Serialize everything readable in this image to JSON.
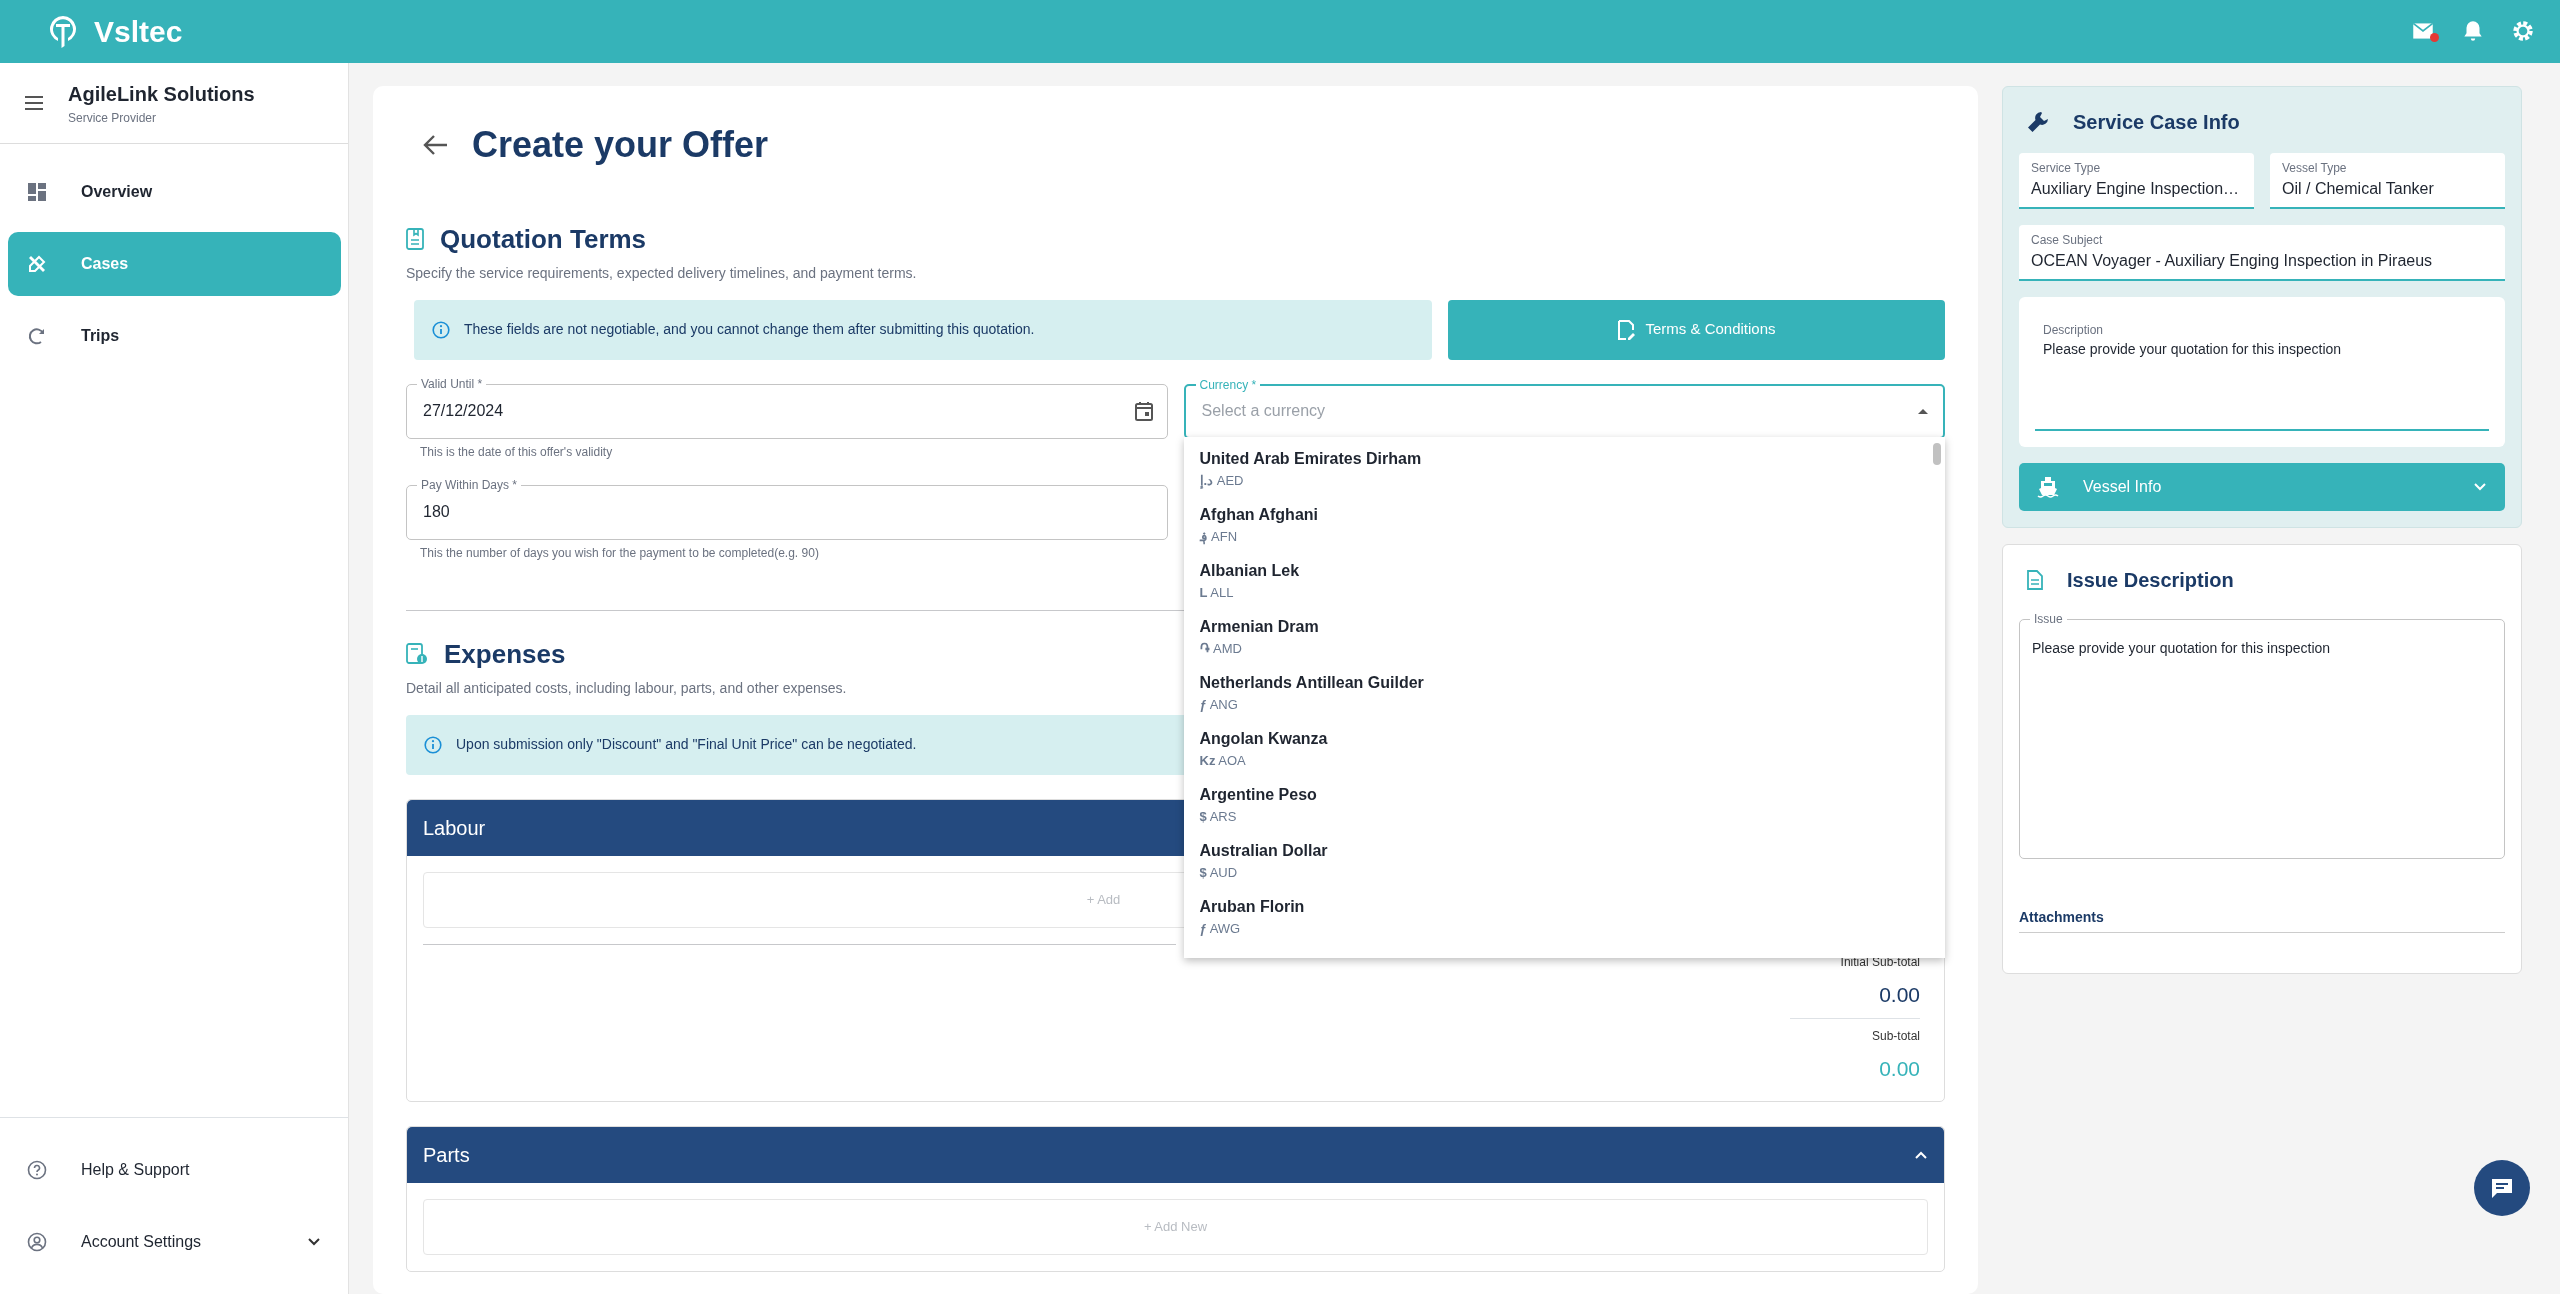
{
  "app": {
    "brand": "Vsltec"
  },
  "topbar": {
    "icons": [
      {
        "kind": "mail",
        "unread": true
      },
      {
        "kind": "bell",
        "unread": false
      },
      {
        "kind": "settings",
        "unread": false
      }
    ]
  },
  "sidebar": {
    "org": "AgileLink Solutions",
    "role": "Service Provider",
    "items": [
      {
        "label": "Overview",
        "selected": false
      },
      {
        "label": "Cases",
        "selected": true
      },
      {
        "label": "Trips",
        "selected": false
      }
    ],
    "footer_items": [
      {
        "label": "Help & Support"
      },
      {
        "label": "Account Settings",
        "expanded": false
      }
    ]
  },
  "page": {
    "title": "Create your Offer"
  },
  "quotation": {
    "title": "Quotation Terms",
    "description": "Specify the service requirements, expected delivery timelines, and payment terms.",
    "notice": "These fields are not negotiable, and you cannot change them after submitting this quotation.",
    "terms_button": "Terms & Conditions",
    "valid_until": {
      "label": "Valid Until *",
      "value": "27/12/2024",
      "helper": "This is the date of this offer's validity"
    },
    "pay_within_days": {
      "label": "Pay Within Days *",
      "value": "180",
      "helper": "This the number of days you wish for the payment to be completed(e.g. 90)"
    },
    "currency": {
      "label": "Currency *",
      "placeholder": "Select a currency",
      "open": true,
      "options": [
        {
          "name": "United Arab Emirates Dirham",
          "symbol": "د.إ",
          "code": "AED"
        },
        {
          "name": "Afghan Afghani",
          "symbol": "؋",
          "code": "AFN"
        },
        {
          "name": "Albanian Lek",
          "symbol": "L",
          "code": "ALL"
        },
        {
          "name": "Armenian Dram",
          "symbol": "֏",
          "code": "AMD"
        },
        {
          "name": "Netherlands Antillean Guilder",
          "symbol": "ƒ",
          "code": "ANG"
        },
        {
          "name": "Angolan Kwanza",
          "symbol": "Kz",
          "code": "AOA"
        },
        {
          "name": "Argentine Peso",
          "symbol": "$",
          "code": "ARS"
        },
        {
          "name": "Australian Dollar",
          "symbol": "$",
          "code": "AUD"
        },
        {
          "name": "Aruban Florin",
          "symbol": "ƒ",
          "code": "AWG"
        }
      ]
    }
  },
  "expenses": {
    "title": "Expenses",
    "description": "Detail all anticipated costs, including labour, parts, and other expenses.",
    "notice": "Upon submission only \"Discount\" and \"Final Unit Price\" can be negotiated.",
    "groups": [
      {
        "title": "Labour",
        "add_label": "+ Add",
        "totals": [
          {
            "kind": "initial",
            "label": "Initial Sub-total",
            "value": "0.00"
          },
          {
            "kind": "final",
            "label": "Sub-total",
            "value": "0.00"
          }
        ]
      },
      {
        "title": "Parts",
        "expanded": true,
        "add_label": "+ Add New"
      }
    ]
  },
  "case_info": {
    "title": "Service Case Info",
    "fields": [
      {
        "label": "Service Type",
        "value": "Auxiliary Engine Inspection…"
      },
      {
        "label": "Vessel Type",
        "value": "Oil / Chemical Tanker"
      },
      {
        "label": "Case Subject",
        "value": "OCEAN Voyager - Auxiliary Enging Inspection in Piraeus"
      }
    ],
    "description": {
      "label": "Description",
      "value": "Please provide your quotation for this inspection"
    },
    "vessel_info": {
      "label": "Vessel Info",
      "expanded": false
    }
  },
  "issue": {
    "title": "Issue Description",
    "label": "Issue",
    "value": "Please provide your quotation for this inspection",
    "attachments": "Attachments"
  }
}
